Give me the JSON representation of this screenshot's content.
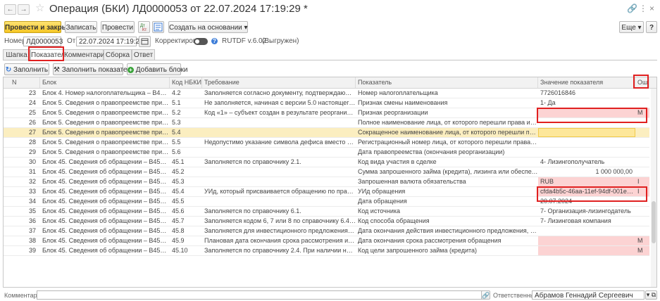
{
  "window": {
    "title": "Операция (БКИ) ЛД0000053 от 22.07.2024 17:19:29 *",
    "back": "←",
    "forward": "→",
    "link": "🔗",
    "menu": "⋮",
    "close": "×"
  },
  "toolbar": {
    "post_close": "Провести и закрыть",
    "save": "Записать",
    "post": "Провести",
    "create_based": "Создать на основании",
    "more": "Еще",
    "help": "?"
  },
  "header": {
    "number_label": "Номер:",
    "number": "ЛД0000053",
    "date_label": "От:",
    "date": "22.07.2024 17:19:29",
    "correction_label": "Корректировка:",
    "format": "RUTDF v.6.02",
    "status": "(Выгружен)"
  },
  "tabs": [
    "Шапка",
    "Показатели",
    "Комментарий",
    "Сборка",
    "Ответ"
  ],
  "grid_toolbar": {
    "fill": "Заполнить",
    "fill_indicators": "Заполнить показатели",
    "add_blocks": "Добавить блоки"
  },
  "columns": [
    "N",
    "Блок",
    "Код НБКИ",
    "Требование",
    "Показатель",
    "Значение показателя",
    "Ош."
  ],
  "rows": [
    {
      "n": "23",
      "block": "Блок 4. Номер налогоплательщика – B4_TAXPAY...",
      "code": "4.2",
      "req": "Заполняется согласно документу, подтверждающему пост...",
      "ind": "Номер налогоплательщика",
      "val": "7726016846",
      "err": "",
      "hl": false
    },
    {
      "n": "24",
      "block": "Блок 5. Сведения о правопреемстве при реорган...",
      "code": "5.1",
      "req": "Не заполняется, начиная с версии 5.0 настоящего формата...",
      "ind": "Признак смены наименования",
      "val": "1- Да",
      "err": "",
      "hl": false
    },
    {
      "n": "25",
      "block": "Блок 5. Сведения о правопреемстве при реорган...",
      "code": "5.2",
      "req": "Код «1» – субъект создан в результате реорганизации; код ...",
      "ind": "Признак реорганизации",
      "val": "",
      "err": "М",
      "hl": true
    },
    {
      "n": "26",
      "block": "Блок 5. Сведения о правопреемстве при реорган...",
      "code": "5.3",
      "req": "",
      "ind": "Полное наименование лица, от которого перешли права и обязанности",
      "val": "",
      "err": "",
      "hl": false
    },
    {
      "n": "27",
      "block": "Блок 5. Сведения о правопреемстве при реорган...",
      "code": "5.4",
      "req": "",
      "ind": "Сокращенное наименование лица, от которого перешли права и обязан...",
      "val": "",
      "err": "",
      "hl": false,
      "selected": true
    },
    {
      "n": "28",
      "block": "Блок 5. Сведения о правопреемстве при реорган...",
      "code": "5.5",
      "req": "Недопустимо указание символа дефиса вместо значения.",
      "ind": "Регистрационный номер лица, от которого перешли права и обязанности",
      "val": "",
      "err": "",
      "hl": false
    },
    {
      "n": "29",
      "block": "Блок 5. Сведения о правопреемстве при реорган...",
      "code": "5.6",
      "req": "",
      "ind": "Дата правопреемства (окончания реорганизации)",
      "val": "",
      "err": "",
      "hl": false
    },
    {
      "n": "30",
      "block": "Блок 45. Сведения об обращении – B45_APPLIC...",
      "code": "45.1",
      "req": "Заполняется по справочнику 2.1.",
      "ind": "Код вида участия в сделке",
      "val": "4- Лизингополучатель",
      "err": "",
      "hl": false
    },
    {
      "n": "31",
      "block": "Блок 45. Сведения об обращении – B45_APPLIC...",
      "code": "45.2",
      "req": "",
      "ind": "Сумма запрошенного займа (кредита), лизинга или обеспечения",
      "val": "1 000 000,00",
      "err": "",
      "hl": false,
      "money": true
    },
    {
      "n": "32",
      "block": "Блок 45. Сведения об обращении – B45_APPLIC...",
      "code": "45.3",
      "req": "",
      "ind": "Запрошенная валюта обязательства",
      "val": "RUB",
      "err": "I",
      "hl": true
    },
    {
      "n": "33",
      "block": "Блок 45. Сведения об обращении – B45_APPLIC...",
      "code": "45.4",
      "req": "УИд, который присваивается обращению по правилам, уст...",
      "ind": "УИд обращения",
      "val": "cfda4b5c-46aa-11ef-94df-001e675489f5-2",
      "err": "I",
      "hl": true
    },
    {
      "n": "34",
      "block": "Блок 45. Сведения об обращении – B45_APPLIC...",
      "code": "45.5",
      "req": "",
      "ind": "Дата обращения",
      "val": "20.07.2024",
      "err": "",
      "hl": false
    },
    {
      "n": "35",
      "block": "Блок 45. Сведения об обращении – B45_APPLIC...",
      "code": "45.6",
      "req": "Заполняется по справочнику 6.1.",
      "ind": "Код источника",
      "val": "7- Организация-лизингодатель",
      "err": "",
      "hl": false
    },
    {
      "n": "36",
      "block": "Блок 45. Сведения об обращении – B45_APPLIC...",
      "code": "45.7",
      "req": "Заполняется кодом 6, 7 или 8 по справочнику 6.4.1.",
      "ind": "Код способа обращения",
      "val": "7- Лизинговая компания",
      "err": "",
      "hl": false
    },
    {
      "n": "37",
      "block": "Блок 45. Сведения об обращении – B45_APPLIC...",
      "code": "45.8",
      "req": "Заполняется для инвестиционного предложения или оферт...",
      "ind": "Дата окончания действия инвестиционного предложения, одобрения об...",
      "val": "",
      "err": "",
      "hl": false
    },
    {
      "n": "38",
      "block": "Блок 45. Сведения об обращении – B45_APPLIC...",
      "code": "45.9",
      "req": "Плановая дата окончания срока рассмотрения источником ...",
      "ind": "Дата окончания срока рассмотрения обращения",
      "val": "",
      "err": "М",
      "hl": true
    },
    {
      "n": "39",
      "block": "Блок 45. Сведения об обращении – B45_APPLIC...",
      "code": "45.10",
      "req": "Заполняется по справочнику 2.4. При наличии нескольких ...",
      "ind": "Код цели запрошенного займа (кредита)",
      "val": "",
      "err": "М",
      "hl": true
    }
  ],
  "footer": {
    "comment_label": "Комментарий:",
    "responsible_label": "Ответственный:",
    "responsible": "Абрамов Геннадий Сергеевич"
  }
}
